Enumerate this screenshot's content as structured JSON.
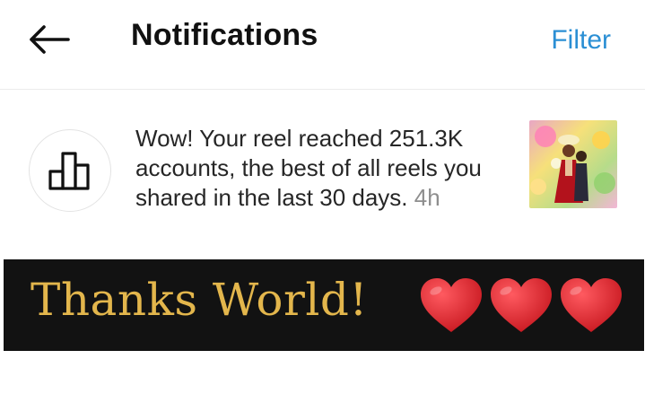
{
  "header": {
    "title": "Notifications",
    "filter_label": "Filter"
  },
  "notification": {
    "message": "Wow! Your reel reached 251.3K accounts, the best of all reels you shared in the last 30 days.",
    "time": "4h"
  },
  "banner": {
    "text": "Thanks World!",
    "heart_count": 3
  },
  "colors": {
    "link": "#2b8fd4",
    "banner_bg": "#121212",
    "banner_text": "#e3b64c",
    "heart": "#d11f27"
  },
  "icons": {
    "back": "arrow-left-icon",
    "insights": "bar-chart-icon",
    "heart": "heart-icon"
  }
}
